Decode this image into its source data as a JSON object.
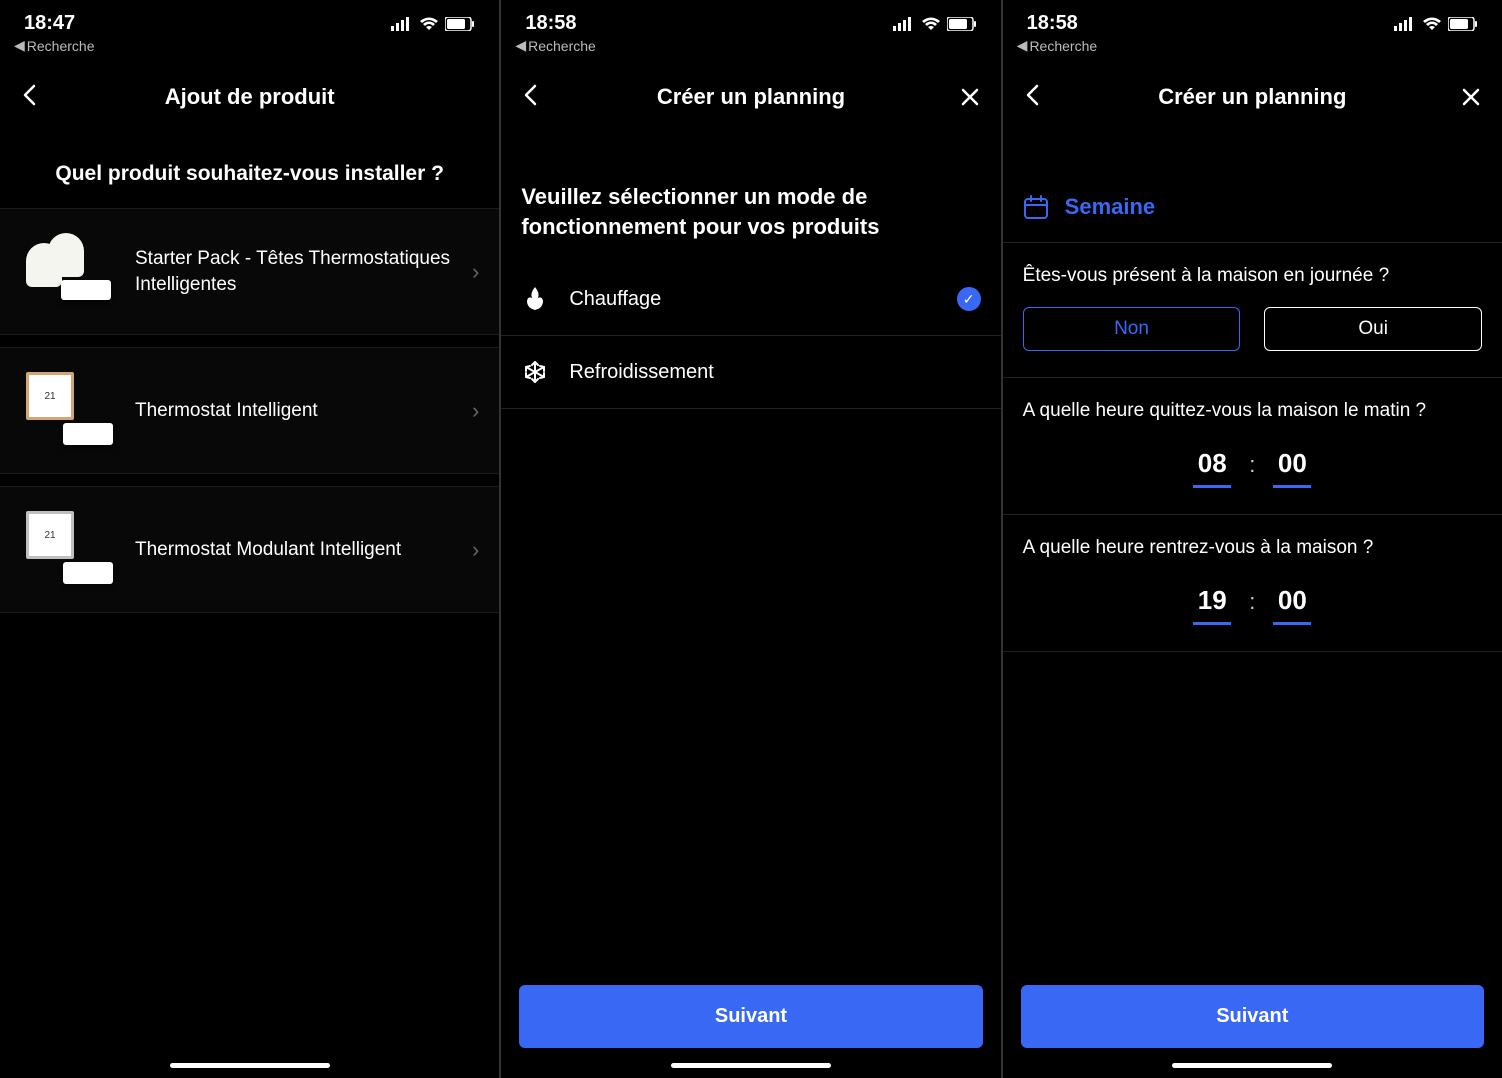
{
  "screen1": {
    "status": {
      "time": "18:47",
      "back_app": "Recherche"
    },
    "nav_title": "Ajout de produit",
    "heading": "Quel produit souhaitez-vous installer ?",
    "products": [
      {
        "label": "Starter Pack - Têtes Thermostatiques Intelligentes"
      },
      {
        "label": "Thermostat Intelligent"
      },
      {
        "label": "Thermostat Modulant Intelligent"
      }
    ]
  },
  "screen2": {
    "status": {
      "time": "18:58",
      "back_app": "Recherche"
    },
    "nav_title": "Créer un planning",
    "heading": "Veuillez sélectionner un mode de fonctionnement pour vos produits",
    "modes": [
      {
        "label": "Chauffage",
        "selected": true
      },
      {
        "label": "Refroidissement",
        "selected": false
      }
    ],
    "next_btn": "Suivant"
  },
  "screen3": {
    "status": {
      "time": "18:58",
      "back_app": "Recherche"
    },
    "nav_title": "Créer un planning",
    "week_label": "Semaine",
    "q_present": "Êtes-vous présent à la maison en journée ?",
    "opt_no": "Non",
    "opt_yes": "Oui",
    "q_leave": "A quelle heure quittez-vous la maison le matin ?",
    "leave_h": "08",
    "leave_m": "00",
    "q_return": "A quelle heure rentrez-vous à la maison ?",
    "return_h": "19",
    "return_m": "00",
    "next_btn": "Suivant"
  }
}
